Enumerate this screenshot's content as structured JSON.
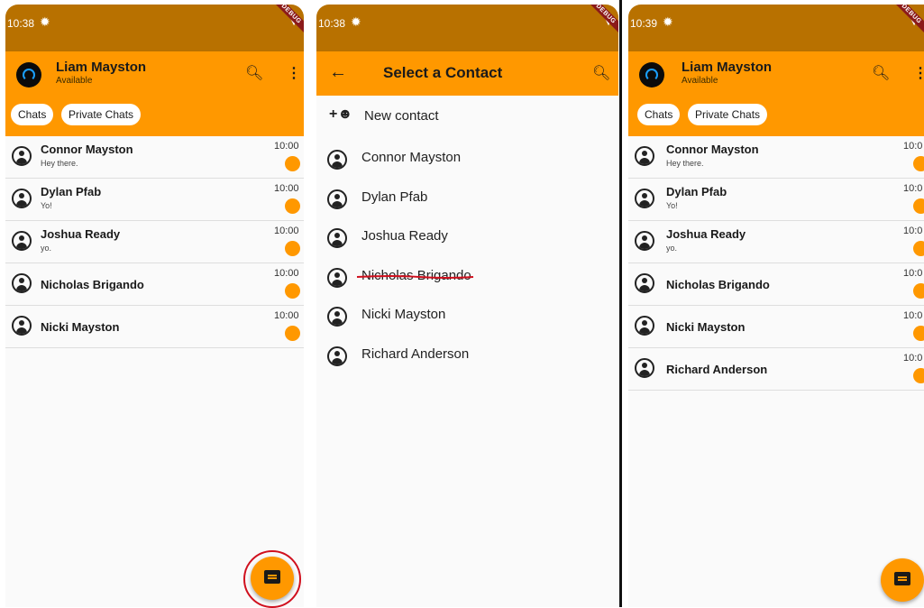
{
  "status": {
    "time_1": "10:38",
    "time_2": "10:38",
    "time_3": "10:39",
    "debug_label": "DEBUG"
  },
  "header": {
    "user_name": "Liam Mayston",
    "user_status": "Available"
  },
  "tabs": [
    {
      "label": "Chats"
    },
    {
      "label": "Private Chats"
    }
  ],
  "chats_before": [
    {
      "name": "Connor Mayston",
      "message": "Hey there.",
      "time": "10:00"
    },
    {
      "name": "Dylan Pfab",
      "message": "Yo!",
      "time": "10:00"
    },
    {
      "name": "Joshua Ready",
      "message": "yo.",
      "time": "10:00"
    },
    {
      "name": "Nicholas Brigando",
      "message": "",
      "time": "10:00"
    },
    {
      "name": "Nicki Mayston",
      "message": "",
      "time": "10:00"
    }
  ],
  "select_contact": {
    "title": "Select a Contact",
    "new_contact_label": "New contact",
    "contacts": [
      "Connor Mayston",
      "Dylan Pfab",
      "Joshua Ready",
      "Nicholas Brigando",
      "Nicki Mayston",
      "Richard Anderson"
    ]
  },
  "chats_after": [
    {
      "name": "Connor Mayston",
      "message": "Hey there.",
      "time": "10:0"
    },
    {
      "name": "Dylan Pfab",
      "message": "Yo!",
      "time": "10:0"
    },
    {
      "name": "Joshua Ready",
      "message": "yo.",
      "time": "10:0"
    },
    {
      "name": "Nicholas Brigando",
      "message": "",
      "time": "10:0"
    },
    {
      "name": "Nicki Mayston",
      "message": "",
      "time": "10:0"
    },
    {
      "name": "Richard Anderson",
      "message": "",
      "time": "10:0"
    }
  ],
  "icons": {
    "settings": "gear-icon",
    "wifi": "wifi-icon",
    "search": "search-icon",
    "menu": "more-vert-icon",
    "back": "arrow-back-icon",
    "add_person": "person-add-icon",
    "chat": "chat-icon"
  },
  "colors": {
    "accent": "#ff9800",
    "status_bar": "#b87100",
    "annotation": "#d0101e"
  }
}
